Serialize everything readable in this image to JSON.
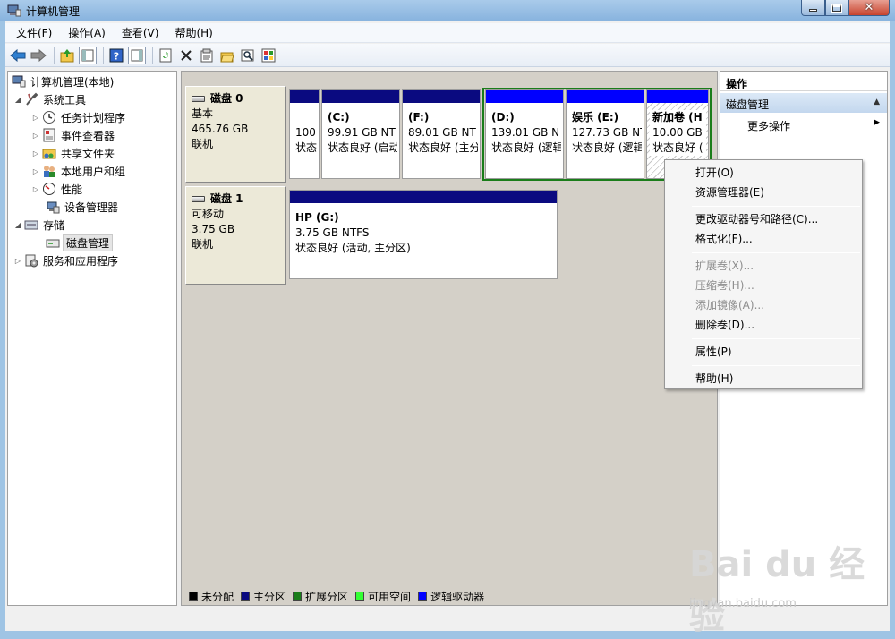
{
  "window": {
    "title": "计算机管理"
  },
  "menubar": [
    "文件(F)",
    "操作(A)",
    "查看(V)",
    "帮助(H)"
  ],
  "toolbar": [
    "back-icon",
    "forward-icon",
    "up-folder-icon",
    "show-tree-icon",
    "help-icon",
    "show-pane-icon",
    "refresh-icon",
    "delete-icon",
    "properties-icon",
    "open-folder-icon",
    "search-icon",
    "console-icon"
  ],
  "tree": {
    "root": "计算机管理(本地)",
    "system_tools": "系统工具",
    "task_scheduler": "任务计划程序",
    "event_viewer": "事件查看器",
    "shared_folders": "共享文件夹",
    "local_users": "本地用户和组",
    "performance": "性能",
    "device_manager": "设备管理器",
    "storage": "存储",
    "disk_management": "磁盘管理",
    "services": "服务和应用程序"
  },
  "disks": [
    {
      "name": "磁盘 0",
      "type": "基本",
      "size": "465.76 GB",
      "status": "联机",
      "volumes": [
        {
          "name": "",
          "size": "100",
          "status": "状态",
          "band": "#0a0a80"
        },
        {
          "name": "(C:)",
          "size": "99.91 GB NT",
          "status": "状态良好 (启动",
          "band": "#0a0a80"
        },
        {
          "name": "(F:)",
          "size": "89.01 GB NT",
          "status": "状态良好 (主分",
          "band": "#0a0a80"
        },
        {
          "name": "(D:)",
          "size": "139.01 GB N",
          "status": "状态良好 (逻辑",
          "band": "#0000ff"
        },
        {
          "name": "娱乐  (E:)",
          "size": "127.73 GB NT",
          "status": "状态良好 (逻辑",
          "band": "#0000ff"
        },
        {
          "name": "新加卷  (H",
          "size": "10.00 GB",
          "status": "状态良好 (",
          "band": "#0000ff"
        }
      ]
    },
    {
      "name": "磁盘 1",
      "type": "可移动",
      "size": "3.75 GB",
      "status": "联机",
      "volumes": [
        {
          "name": "HP  (G:)",
          "size": "3.75 GB NTFS",
          "status": "状态良好 (活动, 主分区)",
          "band": "#0a0a80"
        }
      ]
    }
  ],
  "legend": [
    {
      "label": "未分配",
      "color": "#000000"
    },
    {
      "label": "主分区",
      "color": "#0a0a80"
    },
    {
      "label": "扩展分区",
      "color": "#1a7d1a"
    },
    {
      "label": "可用空间",
      "color": "#33ff33"
    },
    {
      "label": "逻辑驱动器",
      "color": "#0000ff"
    }
  ],
  "actions": {
    "header": "操作",
    "section": "磁盘管理",
    "more": "更多操作"
  },
  "context_menu": {
    "open": "打开(O)",
    "explorer": "资源管理器(E)",
    "change_letter": "更改驱动器号和路径(C)...",
    "format": "格式化(F)...",
    "extend": "扩展卷(X)...",
    "shrink": "压缩卷(H)...",
    "mirror": "添加镜像(A)...",
    "delete": "删除卷(D)...",
    "properties": "属性(P)",
    "help": "帮助(H)"
  },
  "watermark": {
    "logo": "Bai du 经验",
    "url": "jingyan.baidu.com"
  }
}
